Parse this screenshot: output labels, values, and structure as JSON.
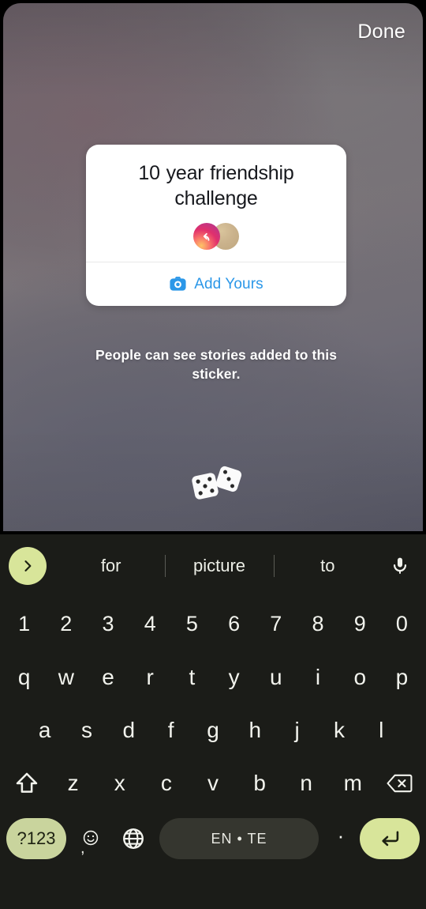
{
  "topbar": {
    "done_label": "Done"
  },
  "sticker": {
    "title": "10 year friendship challenge",
    "add_yours_label": "Add Yours",
    "camera_icon": "camera-icon",
    "camera_color": "#2b97e8",
    "avatars": [
      {
        "name": "reply-avatar",
        "icon": "reply-arrow-icon",
        "color": "#e1306c"
      },
      {
        "name": "friend-avatar",
        "icon": "blank-avatar",
        "color": "#cbb38d"
      }
    ],
    "caption": "People can see stories added to this sticker."
  },
  "dice_sticker": {
    "icon": "dice-icon",
    "die_left_value": 5,
    "die_right_value": 3
  },
  "keyboard": {
    "expand_icon": "chevron-right-icon",
    "expand_color": "#d8e59a",
    "mic_icon": "microphone-icon",
    "suggestions": [
      "for",
      "picture",
      "to"
    ],
    "rows": [
      [
        "1",
        "2",
        "3",
        "4",
        "5",
        "6",
        "7",
        "8",
        "9",
        "0"
      ],
      [
        "q",
        "w",
        "e",
        "r",
        "t",
        "y",
        "u",
        "i",
        "o",
        "p"
      ],
      [
        "a",
        "s",
        "d",
        "f",
        "g",
        "h",
        "j",
        "k",
        "l"
      ],
      [
        "z",
        "x",
        "c",
        "v",
        "b",
        "n",
        "m"
      ]
    ],
    "shift_icon": "shift-up-arrow-icon",
    "backspace_icon": "backspace-icon",
    "symbols_label": "?123",
    "symbols_color": "#c9d49d",
    "emoji_icon": "emoji-smiley-icon",
    "comma_label": ",",
    "language_icon": "globe-icon",
    "space_label": "EN • TE",
    "period_label": "·",
    "enter_icon": "enter-return-icon",
    "enter_color": "#d8e59a"
  }
}
